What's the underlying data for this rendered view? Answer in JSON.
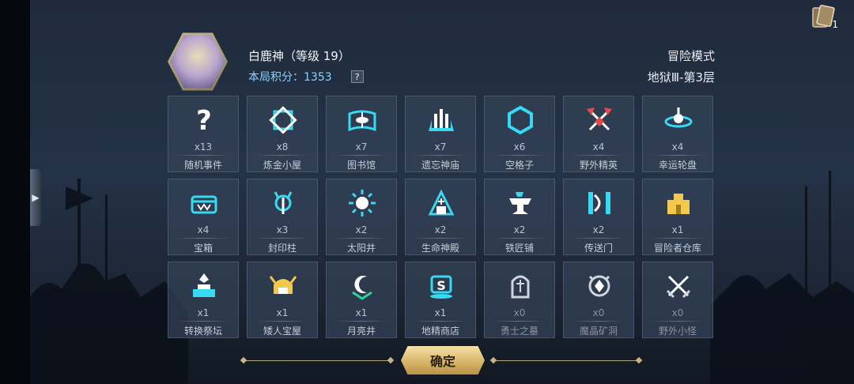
{
  "hero": {
    "name": "白鹿神（等级 19）",
    "score": "本局积分：1353",
    "help": "?"
  },
  "mode": {
    "title": "冒险模式",
    "floor": "地狱Ⅲ-第3层"
  },
  "deck": {
    "count": "1"
  },
  "colors": {
    "icon": "#37d9f3",
    "gold": "#f2c94c",
    "dim_icon": "#cfd5dc",
    "panel": "#344258"
  },
  "tiles": [
    {
      "label": "随机事件",
      "count": "x13",
      "icon": "question-icon"
    },
    {
      "label": "炼金小屋",
      "count": "x8",
      "icon": "alchemy-icon"
    },
    {
      "label": "图书馆",
      "count": "x7",
      "icon": "book-icon"
    },
    {
      "label": "遗忘神庙",
      "count": "x7",
      "icon": "temple-icon"
    },
    {
      "label": "空格子",
      "count": "x6",
      "icon": "hexagon-icon"
    },
    {
      "label": "野外精英",
      "count": "x4",
      "icon": "crossed-axes-icon"
    },
    {
      "label": "幸运轮盘",
      "count": "x4",
      "icon": "wheel-icon"
    },
    {
      "label": "宝箱",
      "count": "x4",
      "icon": "chest-icon"
    },
    {
      "label": "封印柱",
      "count": "x3",
      "icon": "seal-pillar-icon"
    },
    {
      "label": "太阳井",
      "count": "x2",
      "icon": "sun-well-icon"
    },
    {
      "label": "生命神殿",
      "count": "x2",
      "icon": "life-shrine-icon"
    },
    {
      "label": "铁匠铺",
      "count": "x2",
      "icon": "anvil-icon"
    },
    {
      "label": "传送门",
      "count": "x2",
      "icon": "portal-icon"
    },
    {
      "label": "冒险者仓库",
      "count": "x1",
      "icon": "warehouse-icon"
    },
    {
      "label": "转换祭坛",
      "count": "x1",
      "icon": "altar-icon"
    },
    {
      "label": "矮人宝屋",
      "count": "x1",
      "icon": "dwarf-helmet-icon"
    },
    {
      "label": "月亮井",
      "count": "x1",
      "icon": "moon-well-icon"
    },
    {
      "label": "地精商店",
      "count": "x1",
      "icon": "shop-icon"
    },
    {
      "label": "勇士之墓",
      "count": "x0",
      "icon": "tomb-icon"
    },
    {
      "label": "魔晶矿洞",
      "count": "x0",
      "icon": "crystal-mine-icon"
    },
    {
      "label": "野外小怪",
      "count": "x0",
      "icon": "crossed-swords-icon"
    }
  ],
  "confirm": "确定"
}
